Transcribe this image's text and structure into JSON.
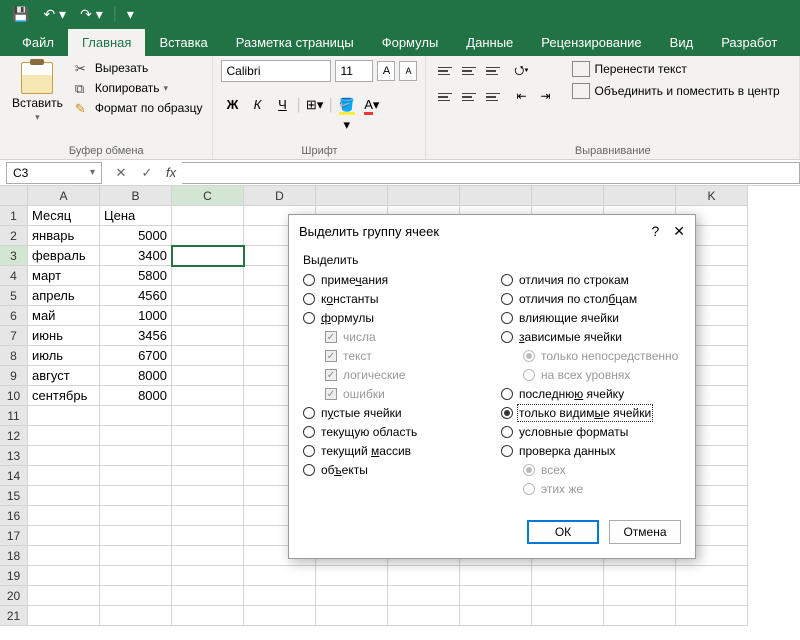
{
  "titlebar": {
    "save_icon": "save-icon",
    "undo_icon": "undo-icon",
    "redo_icon": "redo-icon"
  },
  "tabs": {
    "file": "Файл",
    "home": "Главная",
    "insert": "Вставка",
    "layout": "Разметка страницы",
    "formulas": "Формулы",
    "data": "Данные",
    "review": "Рецензирование",
    "view": "Вид",
    "developer": "Разработ"
  },
  "ribbon": {
    "clipboard": {
      "paste": "Вставить",
      "cut": "Вырезать",
      "copy": "Копировать",
      "format_painter": "Формат по образцу",
      "group_label": "Буфер обмена"
    },
    "font": {
      "name": "Calibri",
      "size": "11",
      "bold": "Ж",
      "italic": "К",
      "underline": "Ч",
      "group_label": "Шрифт"
    },
    "alignment": {
      "wrap": "Перенести текст",
      "merge": "Объединить и поместить в центр",
      "group_label": "Выравнивание"
    }
  },
  "formula_bar": {
    "name_box": "C3",
    "value": ""
  },
  "sheet": {
    "columns": [
      "A",
      "B",
      "C",
      "D",
      "",
      "",
      "",
      "",
      "",
      "K"
    ],
    "rows": [
      {
        "n": 1,
        "A": "Месяц",
        "B": "Цена"
      },
      {
        "n": 2,
        "A": "январь",
        "B": "5000"
      },
      {
        "n": 3,
        "A": "февраль",
        "B": "3400"
      },
      {
        "n": 4,
        "A": "март",
        "B": "5800"
      },
      {
        "n": 5,
        "A": "апрель",
        "B": "4560"
      },
      {
        "n": 6,
        "A": "май",
        "B": "1000"
      },
      {
        "n": 7,
        "A": "июнь",
        "B": "3456"
      },
      {
        "n": 8,
        "A": "июль",
        "B": "6700"
      },
      {
        "n": 9,
        "A": "август",
        "B": "8000"
      },
      {
        "n": 10,
        "A": "сентябрь",
        "B": "8000"
      },
      {
        "n": 11
      },
      {
        "n": 12
      },
      {
        "n": 13
      },
      {
        "n": 14
      },
      {
        "n": 15
      },
      {
        "n": 16
      },
      {
        "n": 17
      },
      {
        "n": 18
      },
      {
        "n": 19
      },
      {
        "n": 20
      },
      {
        "n": 21
      }
    ],
    "selected": "C3"
  },
  "dialog": {
    "title": "Выделить группу ячеек",
    "help": "?",
    "close": "✕",
    "legend": "Выделить",
    "left": {
      "comments": "примечания",
      "constants": "константы",
      "formulas": "формулы",
      "numbers": "числа",
      "text": "текст",
      "logicals": "логические",
      "errors": "ошибки",
      "blanks": "пустые ячейки",
      "current_region": "текущую область",
      "current_array": "текущий массив",
      "objects": "объекты"
    },
    "right": {
      "row_diffs": "отличия по строкам",
      "col_diffs": "отличия по столбцам",
      "precedents": "влияющие ячейки",
      "dependents": "зависимые ячейки",
      "direct_only": "только непосредственно",
      "all_levels": "на всех уровнях",
      "last_cell": "последнюю ячейку",
      "visible_only": "только видимые ячейки",
      "cond_formats": "условные форматы",
      "data_validation": "проверка данных",
      "all": "всех",
      "same": "этих же"
    },
    "selected_option": "visible_only",
    "ok": "ОК",
    "cancel": "Отмена"
  }
}
